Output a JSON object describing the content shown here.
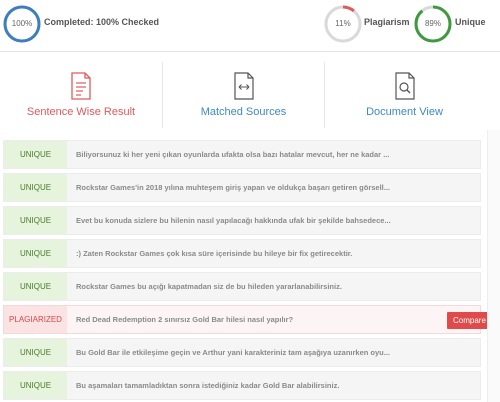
{
  "header": {
    "completed_pct": "100%",
    "completed_label": "Completed: 100% Checked",
    "plagiarism_pct": "11%",
    "plagiarism_label": "Plagiarism",
    "unique_pct": "89%",
    "unique_label": "Unique",
    "completed_fraction": 1.0,
    "plagiarism_fraction": 0.11,
    "unique_fraction": 0.89
  },
  "colors": {
    "completed_ring": "#3c7fc0",
    "plagiarism_ring": "#e05a5a",
    "unique_ring": "#3f9a3f",
    "ring_track": "#d9d9d9"
  },
  "tabs": [
    {
      "label": "Sentence Wise Result",
      "icon": "document-list-icon"
    },
    {
      "label": "Matched Sources",
      "icon": "document-arrows-icon"
    },
    {
      "label": "Document View",
      "icon": "document-search-icon"
    }
  ],
  "rows": [
    {
      "status": "UNIQUE",
      "text": "Biliyorsunuz ki her yeni çıkan oyunlarda ufakta olsa bazı hatalar mevcut, her ne kadar ..."
    },
    {
      "status": "UNIQUE",
      "text": "Rockstar Games'in 2018 yılına muhteşem giriş yapan ve oldukça başarı getiren görsell..."
    },
    {
      "status": "UNIQUE",
      "text": "Evet bu konuda sizlere bu hilenin nasıl yapılacağı hakkında ufak bir şekilde bahsedece..."
    },
    {
      "status": "UNIQUE",
      "text": ":) Zaten Rockstar Games çok kısa süre içerisinde bu hileye bir fix getirecektir."
    },
    {
      "status": "UNIQUE",
      "text": "Rockstar Games bu açığı kapatmadan siz de bu hileden yararlanabilirsiniz."
    },
    {
      "status": "PLAGIARIZED",
      "text": "Red Dead Redemption 2 sınırsız Gold Bar hilesi nasıl yapılır?",
      "compare": "Compare"
    },
    {
      "status": "UNIQUE",
      "text": "Bu Gold Bar ile etkileşime geçin ve Arthur yani karakteriniz tam aşağıya uzanırken oyu..."
    },
    {
      "status": "UNIQUE",
      "text": "Bu aşamaları tamamladıktan sonra istediğiniz kadar Gold Bar alabilirsiniz."
    }
  ]
}
